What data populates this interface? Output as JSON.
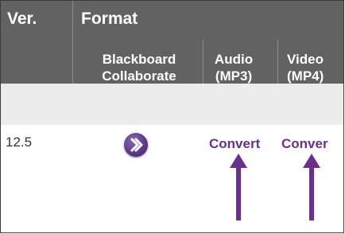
{
  "table": {
    "header": {
      "version": "Ver.",
      "format": "Format",
      "columns": [
        {
          "key": "blackboard",
          "label_line1": "Blackboard",
          "label_line2": "Collaborate"
        },
        {
          "key": "audio",
          "label_line1": "Audio",
          "label_line2": "(MP3)"
        },
        {
          "key": "video",
          "label_line1": "Video",
          "label_line2": "(MP4)"
        }
      ]
    },
    "rows": [
      {
        "version": "12.5",
        "blackboard_icon": "play-chevron-icon",
        "audio_action": "Convert",
        "video_action": "Conver"
      }
    ]
  },
  "annotations": {
    "arrow_color": "#6b2f8c",
    "arrows": [
      "arrow-up-icon",
      "arrow-up-icon"
    ]
  },
  "colors": {
    "header_bg": "#626262",
    "row_bg": "#ececec",
    "link": "#6b2f8c",
    "icon": "#5d3a8a"
  }
}
